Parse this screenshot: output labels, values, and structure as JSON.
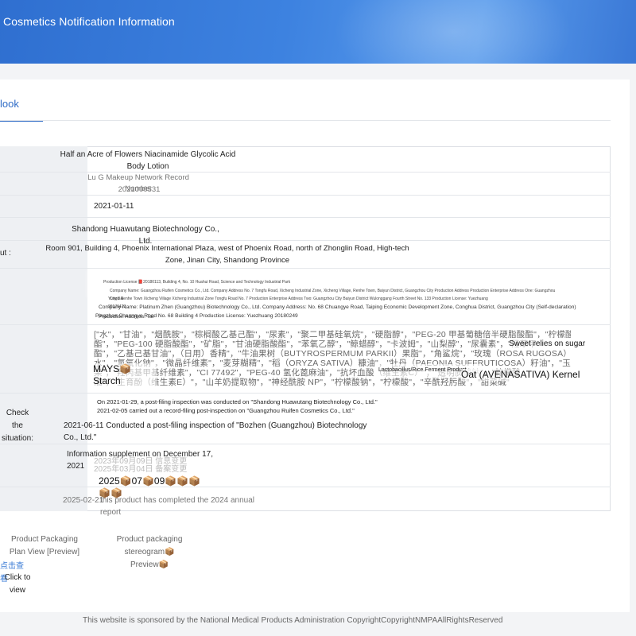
{
  "header": {
    "title": "Cosmetics Notification Information"
  },
  "tabs": [
    {
      "label": "look"
    }
  ],
  "rows": {
    "product_name": "Half an Acre of Flowers Niacinamide Glycolic Acid Body Lotion",
    "record_number_label": "Lu G Makeup Network Record Number",
    "record_number": "2021000531",
    "record_date": "2021-01-11",
    "registrant": "Shandong Huawutang Biotechnology Co., Ltd.",
    "address_label_fragment": "ut :",
    "address": "Room 901, Building 4, Phoenix International Plaza, west of Phoenix Road, north of Zhonglin Road, High-tech Zone, Jinan City, Shandong Province",
    "production": {
      "line1": "Production License 📕20180113, Building 4, No. 10 Huahui Road, Science and Technology Industrial Park",
      "line2": "Company Name: Guangzhou Ruifen Cosmetics Co., Ltd. Company Address No. 7 Tongfu Road, Xicheng Industrial Zone, Xicheng Village, Renhe Town, Baiyun District, Guangzhou City Production Address Production Enterprise Address One: Guangzhou City Bai",
      "line3": "Yunqu Renhe Town Xicheng Village Xicheng Industrial Zone Tongfu Road No. 7 Production Enterprise Address Two: Guangzhou City Baiyun District Wulonggang Fourth Street No. 133 Production License: Yuezhuang 20170423",
      "line4": "Company Name: Platinum Zhen (Guangzhou) Biotechnology Co., Ltd. Company Address: No. 68 Chuangye Road, Taiping Economic Development Zone, Conghua District, Guangzhou City (Self-declaration) Production Address: Tai",
      "line5": "Pingzhen Chuangye Road No. 68 Building 4 Production License: Yuezhuang 20180249"
    },
    "ingredients": {
      "line1": "[\"水\"，\"甘油\"，\"烟酰胺\"，\"棕榈酸乙基己酯\"，\"尿素\"，\"聚二甲基硅氧烷\"，\"硬脂醇\"，\"PEG-20 甲基葡糖倍半硬脂酸酯\"，\"柠檬酸三乙",
      "line2": "酯\"，\"PEG-100 硬脂酸酯\"，\"矿脂\"，\"甘油硬脂酸酯\"，\"苯氧乙醇\"，\"鲸蜡醇\"，\"卡波姆\"，\"山梨醇\"，\"尿囊素\"，\"羟苯甲",
      "line3": "酯\"，\"乙基己基甘油\"，（日用）香精\"，\"牛油果树（BUTYROSPERMUM PARKII）果脂\"，\"角鲨烷\"，\"玫瑰（ROSA RUGOSA）花",
      "line4": "水\"，\"氢氧化钠\"，\"微晶纤维素\"，\"麦芽糊精\"，\"稻（ORYZA SATIVA）糠油\"，\"牡丹（PAEONIA SUFFRUTICOSA）籽油\"，\"玉米（ZEA",
      "line5": "果\"，\"羟丙基甲基纤维素\"，\"CI 77492\"，\"PEG-40 氢化蓖麻油\"，\"抗坏血酸（维生素C）\"，\"透明质酸钠\"，\"柠檬酸",
      "line6": "油\"，\"生育酚（维生素E）\"，\"山羊奶提取物\"，\"神经酰胺 NP\"，\"柠檬酸钠\"，\"柠檬酸\"，\"辛酰羟肟酸\"，\"甜菜碱\"",
      "overlay_sugar": "Sweet relies on sugar",
      "overlay_starch": "MAYS📦Starch",
      "overlay_ferment": "Lactobacillus/Rice Ferment Product",
      "overlay_oat": "Oat (AVENASATIVA) Kernel"
    },
    "check_label": "Check the situation:",
    "inspection": {
      "line1": "On 2021-01-29, a post-filing inspection was conducted on \"Shandong Huawutang Biotechnology Co., Ltd.\"",
      "line2": "2021-02-05 carried out a record-filing post-inspection on \"Guangzhou Ruifen Cosmetics Co., Ltd.\"",
      "line3": "2021-06-11 Conducted a post-filing inspection of \"Bozhen (Guangzhou) Biotechnology Co., Ltd.\""
    },
    "supplement": {
      "main": "Information supplement on December 17, 2021",
      "ghost1": "2023年09月09日 信息变更",
      "ghost2": "2025年03月04日 备案变更",
      "overlay": "2025📦07📦09📦📦📦📦📦"
    },
    "annual": {
      "date": "2025-02-21",
      "text": "this product has completed the 2024 annual report"
    }
  },
  "bottom": {
    "plan_view": "Product Packaging Plan View [Preview]",
    "stereogram": "Product packaging stereogram📦Preview📦",
    "click_zh": "点击查看",
    "click_en": "Click to view"
  },
  "footer": {
    "text": "This website is sponsored by the National Medical Products Administration CopyrightCopyrightNMPAAllRightsReserved"
  }
}
